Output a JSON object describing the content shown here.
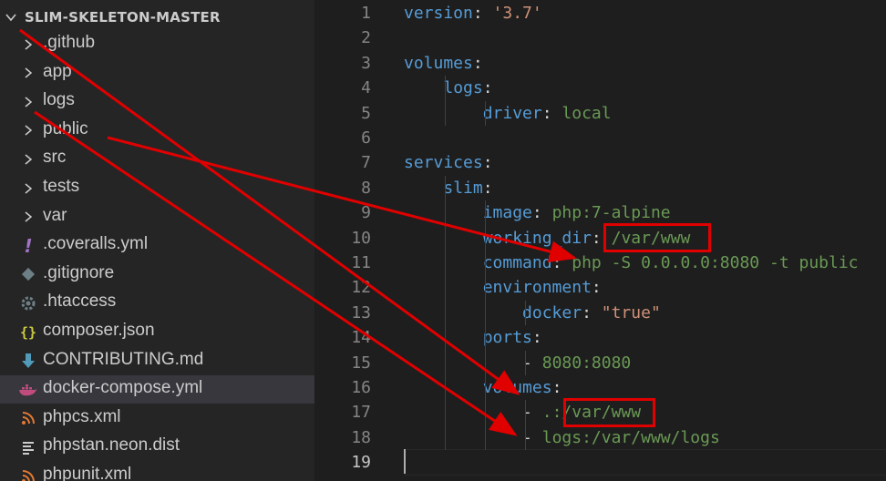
{
  "explorer": {
    "root_label": "SLIM-SKELETON-MASTER",
    "items": [
      {
        "label": ".github",
        "icon": "chevron-right-icon",
        "type": "folder"
      },
      {
        "label": "app",
        "icon": "chevron-right-icon",
        "type": "folder"
      },
      {
        "label": "logs",
        "icon": "chevron-right-icon",
        "type": "folder"
      },
      {
        "label": "public",
        "icon": "chevron-right-icon",
        "type": "folder"
      },
      {
        "label": "src",
        "icon": "chevron-right-icon",
        "type": "folder"
      },
      {
        "label": "tests",
        "icon": "chevron-right-icon",
        "type": "folder"
      },
      {
        "label": "var",
        "icon": "chevron-right-icon",
        "type": "folder"
      },
      {
        "label": ".coveralls.yml",
        "icon": "exclamation-icon",
        "type": "file"
      },
      {
        "label": ".gitignore",
        "icon": "git-icon",
        "type": "file"
      },
      {
        "label": ".htaccess",
        "icon": "gear-icon",
        "type": "file"
      },
      {
        "label": "composer.json",
        "icon": "braces-icon",
        "type": "file"
      },
      {
        "label": "CONTRIBUTING.md",
        "icon": "download-arrow-icon",
        "type": "file"
      },
      {
        "label": "docker-compose.yml",
        "icon": "docker-whale-icon",
        "type": "file",
        "selected": true
      },
      {
        "label": "phpcs.xml",
        "icon": "rss-icon",
        "type": "file"
      },
      {
        "label": "phpstan.neon.dist",
        "icon": "lines-icon",
        "type": "file"
      },
      {
        "label": "phpunit.xml",
        "icon": "rss-icon",
        "type": "file"
      }
    ]
  },
  "editor": {
    "file": "docker-compose.yml",
    "active_line": 19,
    "lines": [
      {
        "n": "1",
        "text": "version: '3.7'"
      },
      {
        "n": "2",
        "text": ""
      },
      {
        "n": "3",
        "text": "volumes:"
      },
      {
        "n": "4",
        "text": "    logs:"
      },
      {
        "n": "5",
        "text": "        driver: local"
      },
      {
        "n": "6",
        "text": ""
      },
      {
        "n": "7",
        "text": "services:"
      },
      {
        "n": "8",
        "text": "    slim:"
      },
      {
        "n": "9",
        "text": "        image: php:7-alpine"
      },
      {
        "n": "10",
        "text": "        working_dir: /var/www"
      },
      {
        "n": "11",
        "text": "        command: php -S 0.0.0.0:8080 -t public"
      },
      {
        "n": "12",
        "text": "        environment:"
      },
      {
        "n": "13",
        "text": "            docker: \"true\""
      },
      {
        "n": "14",
        "text": "        ports:"
      },
      {
        "n": "15",
        "text": "            - 8080:8080"
      },
      {
        "n": "16",
        "text": "        volumes:"
      },
      {
        "n": "17",
        "text": "            - .:/var/www"
      },
      {
        "n": "18",
        "text": "            - logs:/var/www/logs"
      },
      {
        "n": "19",
        "text": ""
      }
    ]
  },
  "colors": {
    "key": "#569cd6",
    "string": "#ce9178",
    "value": "#6a9955",
    "annotation": "#e00000"
  }
}
